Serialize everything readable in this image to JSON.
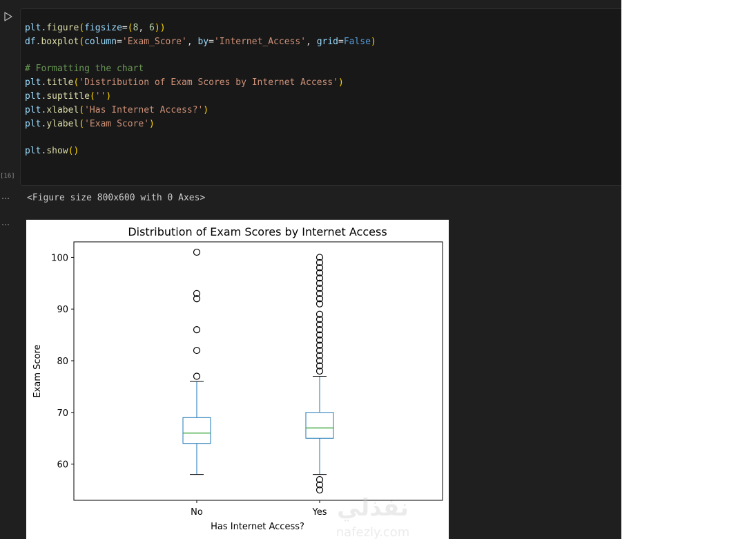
{
  "cell": {
    "execution_count": "[16]",
    "code_lines": [
      [
        [
          "tk-var",
          "plt"
        ],
        [
          "tk-op",
          "."
        ],
        [
          "tk-fn",
          "figure"
        ],
        [
          "tk-paren",
          "("
        ],
        [
          "tk-param",
          "figsize"
        ],
        [
          "tk-op",
          "="
        ],
        [
          "tk-paren",
          "("
        ],
        [
          "tk-num",
          "8"
        ],
        [
          "tk-op",
          ", "
        ],
        [
          "tk-num",
          "6"
        ],
        [
          "tk-paren",
          "))"
        ]
      ],
      [
        [
          "tk-var",
          "df"
        ],
        [
          "tk-op",
          "."
        ],
        [
          "tk-fn",
          "boxplot"
        ],
        [
          "tk-paren",
          "("
        ],
        [
          "tk-param",
          "column"
        ],
        [
          "tk-op",
          "="
        ],
        [
          "tk-str",
          "'Exam_Score'"
        ],
        [
          "tk-op",
          ", "
        ],
        [
          "tk-param",
          "by"
        ],
        [
          "tk-op",
          "="
        ],
        [
          "tk-str",
          "'Internet_Access'"
        ],
        [
          "tk-op",
          ", "
        ],
        [
          "tk-param",
          "grid"
        ],
        [
          "tk-op",
          "="
        ],
        [
          "tk-kw",
          "False"
        ],
        [
          "tk-paren",
          ")"
        ]
      ],
      [],
      [
        [
          "tk-comment",
          "# Formatting the chart"
        ]
      ],
      [
        [
          "tk-var",
          "plt"
        ],
        [
          "tk-op",
          "."
        ],
        [
          "tk-fn",
          "title"
        ],
        [
          "tk-paren",
          "("
        ],
        [
          "tk-str",
          "'Distribution of Exam Scores by Internet Access'"
        ],
        [
          "tk-paren",
          ")"
        ]
      ],
      [
        [
          "tk-var",
          "plt"
        ],
        [
          "tk-op",
          "."
        ],
        [
          "tk-fn",
          "suptitle"
        ],
        [
          "tk-paren",
          "("
        ],
        [
          "tk-str",
          "''"
        ],
        [
          "tk-paren",
          ")"
        ]
      ],
      [
        [
          "tk-var",
          "plt"
        ],
        [
          "tk-op",
          "."
        ],
        [
          "tk-fn",
          "xlabel"
        ],
        [
          "tk-paren",
          "("
        ],
        [
          "tk-str",
          "'Has Internet Access?'"
        ],
        [
          "tk-paren",
          ")"
        ]
      ],
      [
        [
          "tk-var",
          "plt"
        ],
        [
          "tk-op",
          "."
        ],
        [
          "tk-fn",
          "ylabel"
        ],
        [
          "tk-paren",
          "("
        ],
        [
          "tk-str",
          "'Exam Score'"
        ],
        [
          "tk-paren",
          ")"
        ]
      ],
      [],
      [
        [
          "tk-var",
          "plt"
        ],
        [
          "tk-op",
          "."
        ],
        [
          "tk-fn",
          "show"
        ],
        [
          "tk-paren",
          "()"
        ]
      ]
    ]
  },
  "output": {
    "dots": "⋯",
    "text": "<Figure size 800x600 with 0 Axes>"
  },
  "watermark": {
    "arabic": "نفذلي",
    "latin": "nafezly.com"
  },
  "chart_data": {
    "type": "box",
    "title": "Distribution of Exam Scores by Internet Access",
    "xlabel": "Has Internet Access?",
    "ylabel": "Exam Score",
    "categories": [
      "No",
      "Yes"
    ],
    "ylim": [
      53,
      103
    ],
    "yticks": [
      60,
      70,
      80,
      90,
      100
    ],
    "grid": false,
    "box_color": "#1f77b4",
    "median_color": "#2ca02c",
    "boxes": [
      {
        "category": "No",
        "whisker_low": 58,
        "q1": 64,
        "median": 66,
        "q3": 69,
        "whisker_high": 76,
        "outliers": [
          77,
          82,
          86,
          92,
          93,
          101
        ]
      },
      {
        "category": "Yes",
        "whisker_low": 58,
        "q1": 65,
        "median": 67,
        "q3": 70,
        "whisker_high": 77,
        "outliers": [
          55,
          56,
          57,
          78,
          79,
          80,
          81,
          82,
          83,
          84,
          85,
          86,
          87,
          88,
          89,
          91,
          92,
          93,
          94,
          95,
          96,
          97,
          98,
          99,
          100
        ]
      }
    ]
  }
}
